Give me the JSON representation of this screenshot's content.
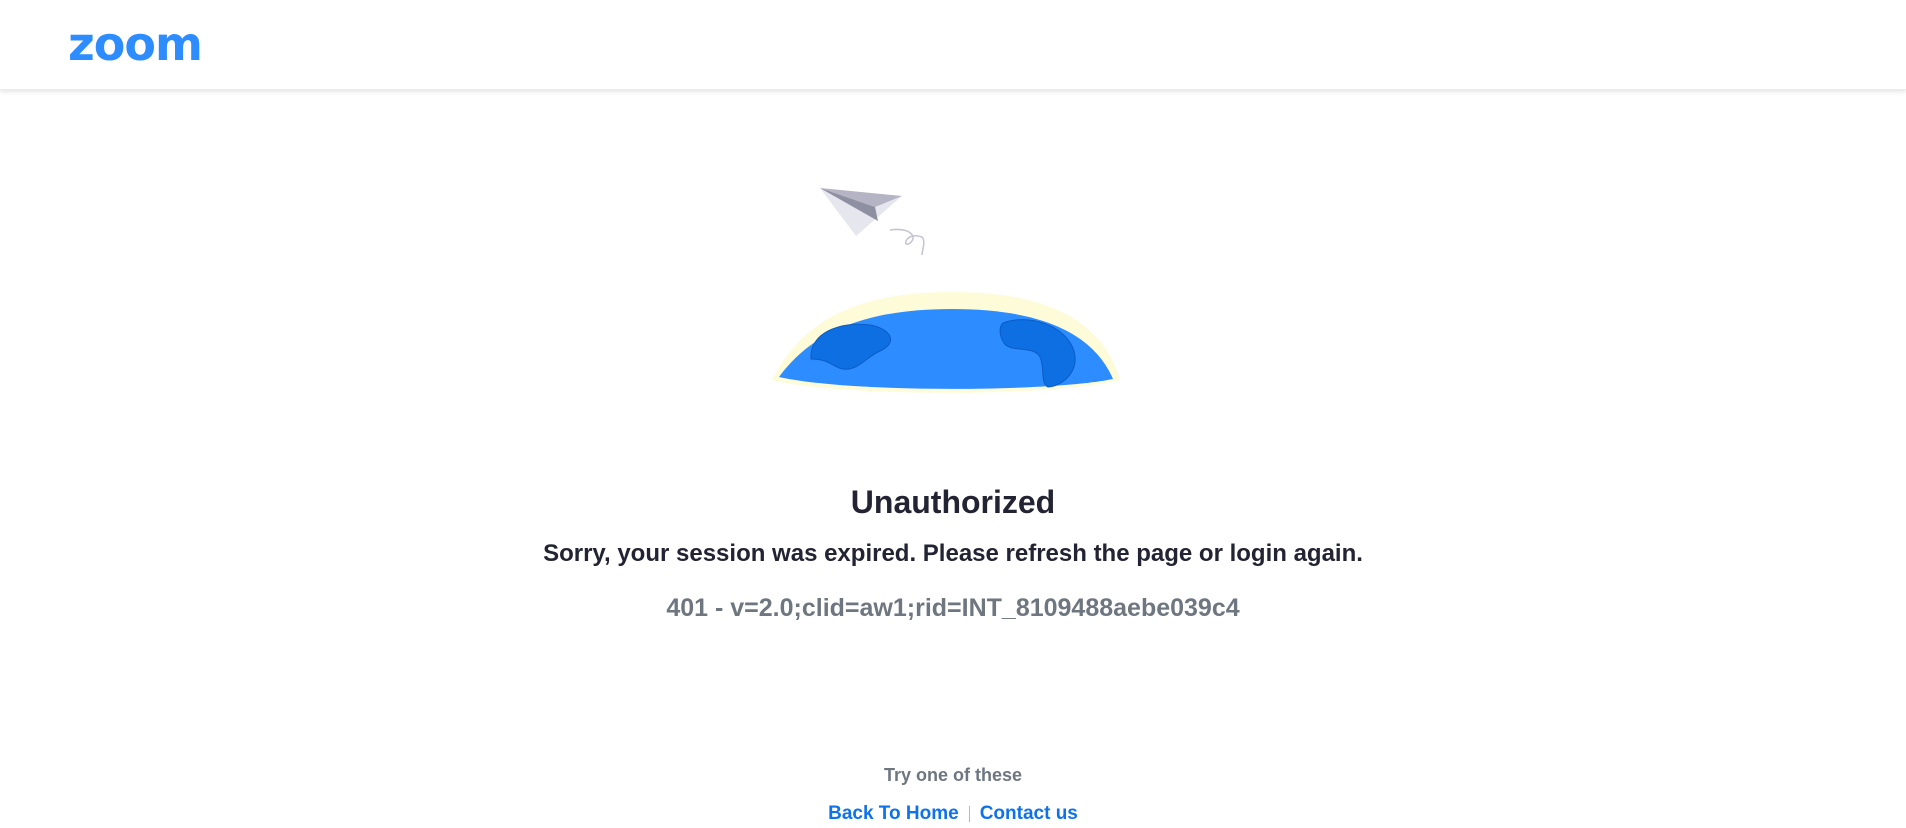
{
  "header": {
    "logo_text": "zoom",
    "brand_color": "#2D8CFF"
  },
  "error": {
    "title": "Unauthorized",
    "message": "Sorry, your session was expired. Please refresh the page or login again.",
    "code": "401 - v=2.0;clid=aw1;rid=INT_8109488aebe039c4"
  },
  "suggestions": {
    "heading": "Try one of these",
    "links": [
      {
        "label": "Back To Home"
      },
      {
        "label": "Contact us"
      }
    ],
    "link_color": "#0E72ED"
  },
  "illustration": {
    "icons": [
      "paper-plane-icon",
      "globe-icon"
    ]
  }
}
